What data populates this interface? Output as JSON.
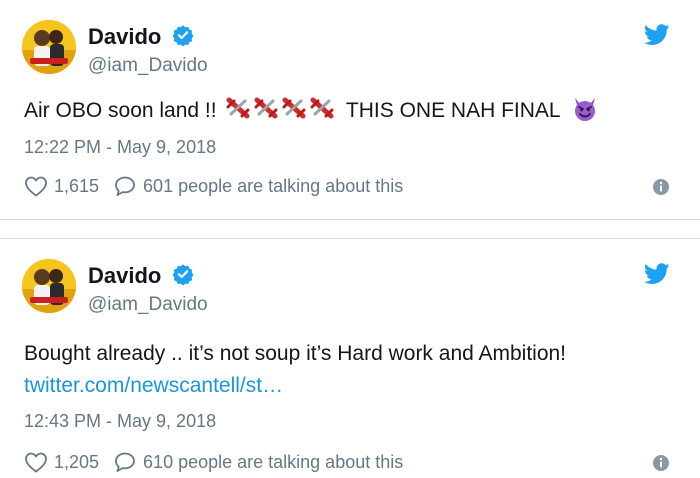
{
  "colors": {
    "link": "#1b95e0",
    "muted": "#657786",
    "verified": "#1da1f2",
    "twitter": "#1da1f2"
  },
  "tweets": [
    {
      "name": "Davido",
      "handle": "@iam_Davido",
      "text_before": "Air OBO soon land !!",
      "text_after": "THIS ONE NAH FINAL",
      "emoji": [
        "airplane-icon",
        "airplane-icon",
        "airplane-icon",
        "airplane-icon",
        "smiling-devil-icon"
      ],
      "timestamp": "12:22 PM - May 9, 2018",
      "likes": "1,615",
      "talking": "601 people are talking about this"
    },
    {
      "name": "Davido",
      "handle": "@iam_Davido",
      "text": "Bought already .. it’s not soup it’s Hard work and Ambition!",
      "link": "twitter.com/newscantell/st…",
      "timestamp": "12:43 PM - May 9, 2018",
      "likes": "1,205",
      "talking": "610 people are talking about this"
    }
  ]
}
